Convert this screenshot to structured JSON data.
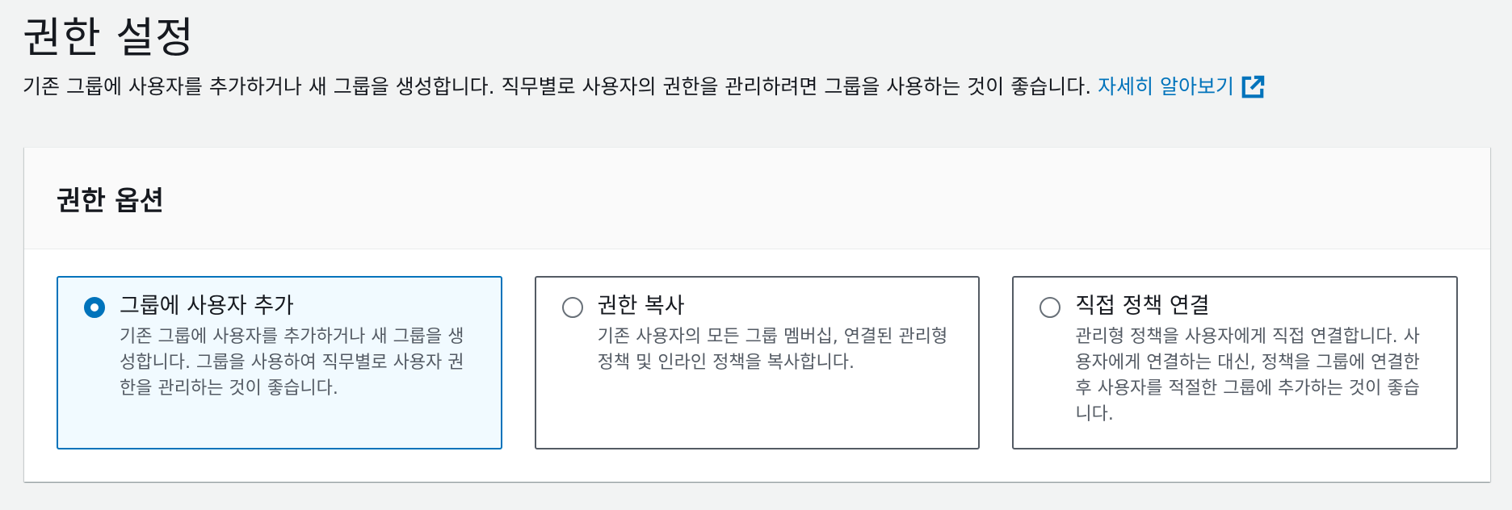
{
  "page": {
    "title": "권한 설정",
    "description": "기존 그룹에 사용자를 추가하거나 새 그룹을 생성합니다. 직무별로 사용자의 권한을 관리하려면 그룹을 사용하는 것이 좋습니다.",
    "learn_more_label": "자세히 알아보기",
    "learn_more_icon": "external-link-icon"
  },
  "panel": {
    "title": "권한 옵션",
    "options": [
      {
        "label": "그룹에 사용자 추가",
        "description": "기존 그룹에 사용자를 추가하거나 새 그룹을 생성합니다. 그룹을 사용하여 직무별로 사용자 권한을 관리하는 것이 좋습니다.",
        "selected": true
      },
      {
        "label": "권한 복사",
        "description": "기존 사용자의 모든 그룹 멤버십, 연결된 관리형 정책 및 인라인 정책을 복사합니다.",
        "selected": false
      },
      {
        "label": "직접 정책 연결",
        "description": "관리형 정책을 사용자에게 직접 연결합니다. 사용자에게 연결하는 대신, 정책을 그룹에 연결한 후 사용자를 적절한 그룹에 추가하는 것이 좋습니다.",
        "selected": false
      }
    ]
  },
  "colors": {
    "background": "#f2f3f3",
    "link": "#0073bb",
    "selected_border": "#0073bb",
    "selected_background": "#f1faff",
    "card_border": "#545b64",
    "text_primary": "#16191f",
    "text_secondary": "#545b64"
  }
}
